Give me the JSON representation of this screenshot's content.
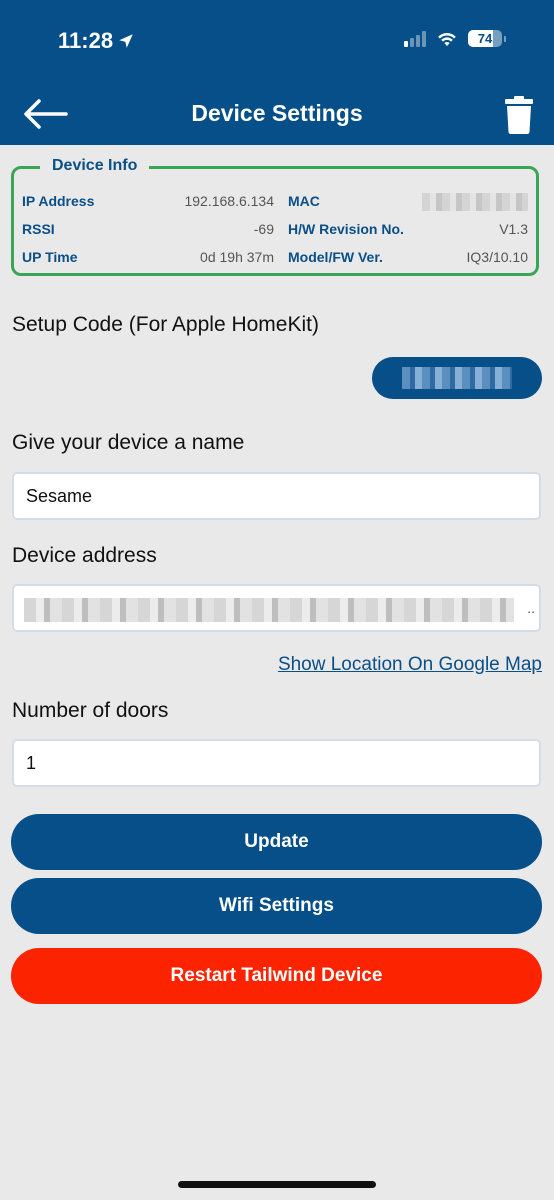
{
  "status_bar": {
    "time": "11:28",
    "signal_bars_on": 1,
    "signal_bars_total": 4,
    "battery_percent": 74,
    "icons": [
      "location-arrow-icon",
      "cellular-signal-icon",
      "wifi-icon",
      "battery-icon"
    ]
  },
  "header": {
    "title": "Device Settings",
    "back_icon": "arrow-left-icon",
    "delete_icon": "trash-icon"
  },
  "device_info": {
    "legend": "Device Info",
    "rows": [
      {
        "label": "IP Address",
        "value": "192.168.6.134",
        "label2": "MAC",
        "value2": "[redacted]"
      },
      {
        "label": "RSSI",
        "value": "-69",
        "label2": "H/W Revision No.",
        "value2": "V1.3"
      },
      {
        "label": "UP Time",
        "value": "0d 19h 37m",
        "label2": "Model/FW Ver.",
        "value2": "IQ3/10.10"
      }
    ]
  },
  "setup_code": {
    "label": "Setup Code (For Apple HomeKit)",
    "value": "[redacted]"
  },
  "device_name": {
    "label": "Give your device a name",
    "value": "Sesame"
  },
  "device_address": {
    "label": "Device address",
    "value": "[redacted]",
    "map_link": "Show Location On Google Map"
  },
  "doors": {
    "label": "Number of doors",
    "value": "1"
  },
  "buttons": {
    "update": "Update",
    "wifi": "Wifi Settings",
    "restart": "Restart Tailwind Device"
  },
  "colors": {
    "primary": "#064f88",
    "danger": "#fc2400",
    "info_border": "#3aa655",
    "background": "#e9e9e9"
  }
}
